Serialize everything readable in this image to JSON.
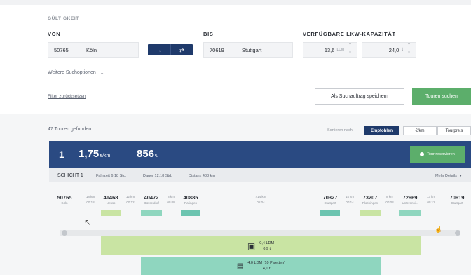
{
  "form": {
    "validity_label": "GÜLTIGKEIT",
    "from_label": "VON",
    "from_zip": "50765",
    "from_city": "Köln",
    "to_label": "BIS",
    "to_zip": "70619",
    "to_city": "Stuttgart",
    "capacity_label": "VERFÜGBARE LKW-KAPAZITÄT",
    "ldm_value": "13,6",
    "ldm_unit": "LDM",
    "weight_value": "24,0",
    "weight_unit": "t",
    "more_options": "Weitere Suchoptionen",
    "reset_filter": "Filter zurücksetzen",
    "save_search": "Als Suchauftrag speichern",
    "search_tours": "Touren suchen"
  },
  "results": {
    "count_text": "47 Touren gefunden",
    "sort_label": "Sortieren nach",
    "sort_options": [
      "Empfohlen",
      "€/km",
      "Tourpreis"
    ]
  },
  "tour": {
    "rank": "1",
    "price_per_km": "1,75",
    "price_per_km_unit": "€/km",
    "total_price": "856",
    "total_unit": "€",
    "reserve_label": "Tour reservieren",
    "shift_label": "SCHICHT 1",
    "drive_time": "Fahrzeit 6:18 Std.",
    "duration": "Dauer 12:18 Std.",
    "distance": "Distanz 488 km",
    "more_details": "Mehr Details",
    "stops": [
      {
        "zip": "50765",
        "city": "Köln"
      },
      {
        "zip": "41468",
        "city": "Neuss"
      },
      {
        "zip": "40472",
        "city": "Düsseldorf"
      },
      {
        "zip": "40885",
        "city": "Ratingen"
      },
      {
        "zip": "70327",
        "city": "Stuttgart"
      },
      {
        "zip": "73207",
        "city": "Plochingen"
      },
      {
        "zip": "72669",
        "city": "Unterensi..."
      },
      {
        "zip": "70619",
        "city": "Stuttgart"
      }
    ],
    "legs": [
      {
        "km": "18 km",
        "time": "00:18"
      },
      {
        "km": "12 km",
        "time": "00:12"
      },
      {
        "km": "8 km",
        "time": "00:08"
      },
      {
        "km": "414 km",
        "time": "05:04"
      },
      {
        "km": "14 km",
        "time": "00:14"
      },
      {
        "km": "8 km",
        "time": "00:08"
      },
      {
        "km": "13 km",
        "time": "00:12"
      }
    ],
    "cargo": [
      {
        "ldm": "0,4 LDM",
        "weight": "0,9 t"
      },
      {
        "ldm": "4,0 LDM (10 Paletten)",
        "weight": "4,0 t"
      }
    ],
    "colors": {
      "green_seg": "#c9e4a3",
      "teal_seg": "#6cc4b0",
      "navy": "#2a4a82"
    }
  }
}
